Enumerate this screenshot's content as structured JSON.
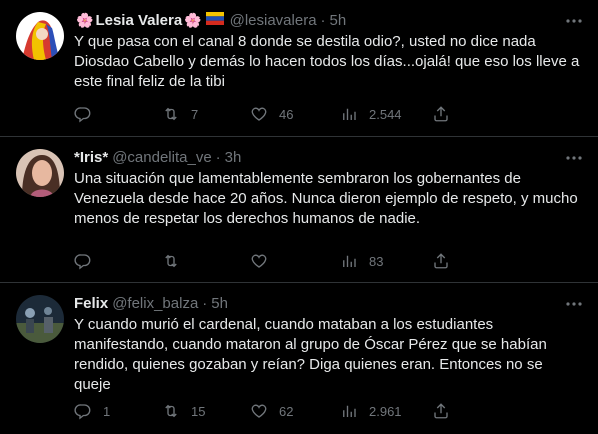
{
  "tweets": [
    {
      "name": "Lesia Valera",
      "name_prefix_emoji": "🌸",
      "name_suffix_emoji": "🌸",
      "flag_emoji": "🇻🇪",
      "handle": "@lesiavalera",
      "dot": "·",
      "time": "5h",
      "text": "Y que pasa con el canal 8 donde se destila odio?, usted no dice nada Diosdao Cabello y demás lo hacen todos los días...ojalá! que eso los lleve a este final feliz de la tibi",
      "replies": "",
      "retweets": "7",
      "likes": "46",
      "views": "2.544",
      "avatar_colors": [
        "#c22",
        "#fff",
        "#3355cc"
      ]
    },
    {
      "name": "*Iris*",
      "handle": "@candelita_ve",
      "dot": "·",
      "time": "3h",
      "text": "Una situación que lamentablemente sembraron los gobernantes de Venezuela desde hace 20 años. Nunca dieron ejemplo de respeto, y mucho menos de respetar los derechos humanos de nadie.",
      "replies": "",
      "retweets": "",
      "likes": "",
      "views": "83",
      "avatar_colors": [
        "#c9a28c",
        "#5a3b2e"
      ]
    },
    {
      "name": "Felix",
      "handle": "@felix_balza",
      "dot": "·",
      "time": "5h",
      "text": "Y cuando murió el cardenal, cuando mataban a los estudiantes manifestando, cuando mataron al grupo de Óscar Pérez que se habían rendido, quienes gozaban y reían? Diga quienes eran.  Entonces no se queje",
      "replies": "1",
      "retweets": "15",
      "likes": "62",
      "views": "2.961",
      "avatar_colors": [
        "#2a3a4a",
        "#7a8a70"
      ]
    }
  ],
  "colors": {
    "background": "#000000",
    "text": "#e7e9ea",
    "secondary": "#71767b",
    "divider": "#2f3336"
  }
}
